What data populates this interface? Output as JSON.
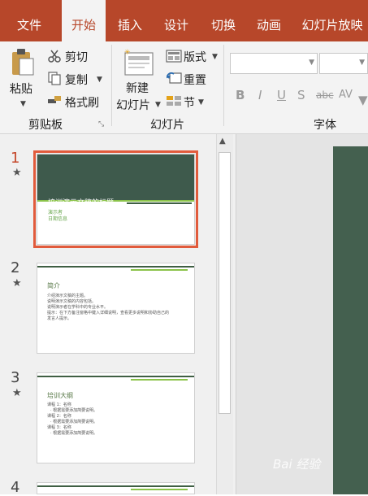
{
  "tabs": [
    "文件",
    "开始",
    "插入",
    "设计",
    "切换",
    "动画",
    "幻灯片放映"
  ],
  "active_tab": "开始",
  "clipboard": {
    "paste": "粘贴",
    "cut": "剪切",
    "copy": "复制",
    "format_painter": "格式刷",
    "group": "剪贴板"
  },
  "slides_group": {
    "new_slide_line1": "新建",
    "new_slide_line2": "幻灯片",
    "layout": "版式",
    "reset": "重置",
    "section": "节",
    "group": "幻灯片"
  },
  "font_group": {
    "group": "字体",
    "bold": "B",
    "italic": "I",
    "underline": "U",
    "shadow": "S",
    "strike": "abc",
    "spacing": "AV"
  },
  "slides": [
    {
      "number": "1",
      "title": "培训演示文稿的标题",
      "subtitle1": "演示者",
      "subtitle2": "日期信息",
      "selected": true
    },
    {
      "number": "2",
      "heading": "简介",
      "bullets": [
        "介绍演示文稿的主题。",
        "说明演示文稿的内容包括。",
        "说明演示者在学科中的专业水平。",
        "提示：在下方备注窗格中键入详细说明，查看更多说明和协助自己的",
        "发言人提示。"
      ]
    },
    {
      "number": "3",
      "heading": "培训大纲",
      "bullets": [
        "课程 1：名称",
        "· 根据需要添加简要说明。",
        "课程 2：名称",
        "· 根据需要添加简要说明。",
        "课程 3：名称",
        "· 根据需要添加简要说明。"
      ]
    },
    {
      "number": "4"
    }
  ],
  "watermark": "Bai 经验",
  "colors": {
    "accent": "#b7472a",
    "selection": "#e15b3c",
    "slide_dark": "#3e5a4c",
    "slide_green": "#8bc34a"
  }
}
